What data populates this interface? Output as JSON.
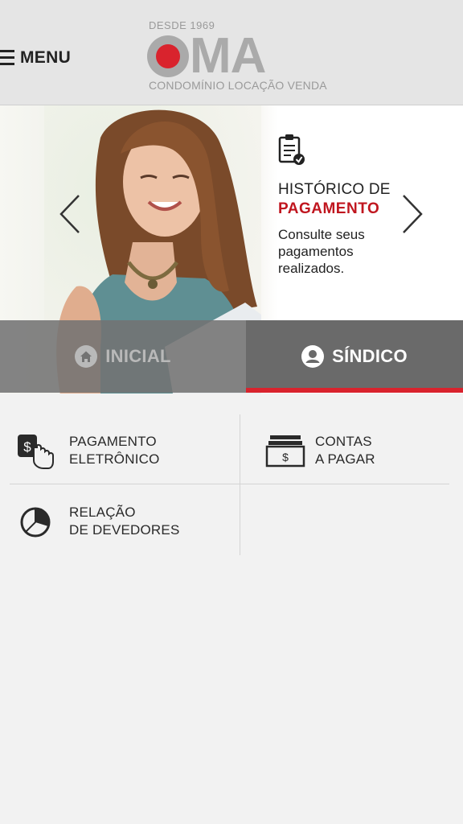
{
  "header": {
    "menu_label": "MENU",
    "logo": {
      "since": "DESDE 1969",
      "mark": "MA",
      "tagline": "CONDOMÍNIO LOCAÇÃO VENDA"
    }
  },
  "hero": {
    "title_line1": "HISTÓRICO DE",
    "title_line2": "PAGAMENTO",
    "description": "Consulte seus pagamentos realizados.",
    "icon": "clipboard-check-icon",
    "accent_color": "#c0161f"
  },
  "tabs": [
    {
      "label": "INICIAL",
      "icon": "home-icon",
      "active": false
    },
    {
      "label": "SÍNDICO",
      "icon": "user-circle-icon",
      "active": true
    }
  ],
  "grid": {
    "items": [
      {
        "line1": "PAGAMENTO",
        "line2": "ELETRÔNICO",
        "icon": "payment-touch-icon"
      },
      {
        "line1": "CONTAS",
        "line2": "A PAGAR",
        "icon": "bills-icon"
      },
      {
        "line1": "RELAÇÃO",
        "line2": "DE DEVEDORES",
        "icon": "pie-chart-icon"
      }
    ]
  },
  "colors": {
    "brand_red": "#d9232d",
    "logo_gray": "#aaaaaa",
    "header_bg": "#e5e5e5"
  }
}
